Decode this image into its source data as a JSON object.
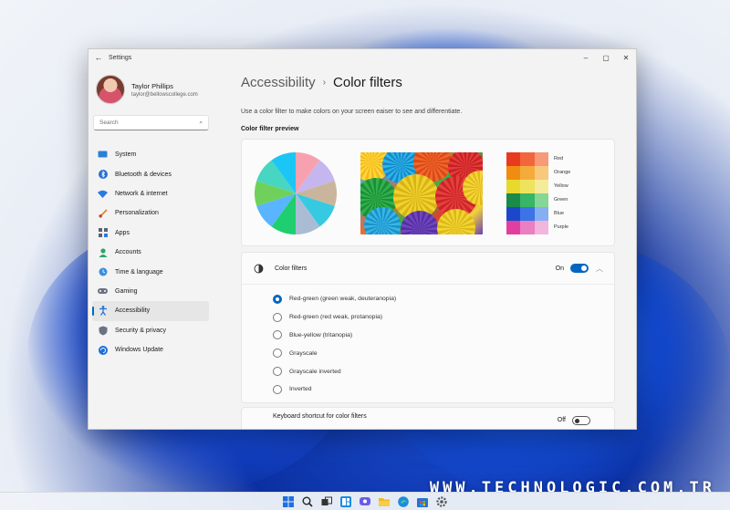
{
  "window": {
    "title": "Settings",
    "controls": [
      "–",
      "▢",
      "✕"
    ]
  },
  "profile": {
    "name": "Taylor Phillips",
    "email": "taylor@bellowscollege.com"
  },
  "search": {
    "placeholder": "Search"
  },
  "sidebar": {
    "items": [
      {
        "label": "System",
        "icon": "monitor-icon"
      },
      {
        "label": "Bluetooth & devices",
        "icon": "bluetooth-icon"
      },
      {
        "label": "Network & internet",
        "icon": "wifi-icon"
      },
      {
        "label": "Personalization",
        "icon": "brush-icon"
      },
      {
        "label": "Apps",
        "icon": "apps-icon"
      },
      {
        "label": "Accounts",
        "icon": "person-icon"
      },
      {
        "label": "Time & language",
        "icon": "globe-clock-icon"
      },
      {
        "label": "Gaming",
        "icon": "gamepad-icon"
      },
      {
        "label": "Accessibility",
        "icon": "accessibility-icon",
        "active": true
      },
      {
        "label": "Security & privacy",
        "icon": "shield-icon"
      },
      {
        "label": "Windows Update",
        "icon": "update-icon"
      }
    ]
  },
  "breadcrumb": {
    "parent": "Accessibility",
    "separator": "›",
    "current": "Color filters"
  },
  "description": "Use a color filter to make colors on your screen eaiser to see and differentiate.",
  "preview": {
    "title": "Color filter preview",
    "pie_colors": [
      "#f7a1b0",
      "#c5b6ef",
      "#c9b59b",
      "#36c9e2",
      "#a9bcd4",
      "#1fcf6f",
      "#59b5ff",
      "#6fd15b",
      "#47d6c1",
      "#1bc6f5"
    ],
    "swatches": [
      {
        "label": "Red",
        "colors": [
          "#e83a1e",
          "#f2663d",
          "#f79a78"
        ]
      },
      {
        "label": "Orange",
        "colors": [
          "#f08c10",
          "#f5ab3c",
          "#f8c87c"
        ]
      },
      {
        "label": "Yellow",
        "colors": [
          "#e8d92c",
          "#efe35e",
          "#f4ec9a"
        ]
      },
      {
        "label": "Green",
        "colors": [
          "#1b8a4a",
          "#38b566",
          "#84d796"
        ]
      },
      {
        "label": "Blue",
        "colors": [
          "#1b47c9",
          "#3c73e6",
          "#86aef2"
        ]
      },
      {
        "label": "Purple",
        "colors": [
          "#e23ea0",
          "#ea7fc1",
          "#f2b6dc"
        ]
      }
    ]
  },
  "color_filters": {
    "label": "Color filters",
    "state": "On",
    "toggle_on": true,
    "options": [
      {
        "label": "Red-green (green weak, deuteranopia)",
        "checked": true
      },
      {
        "label": "Red-green (red weak, protanopia)",
        "checked": false
      },
      {
        "label": "Blue-yellow (tritanopia)",
        "checked": false
      },
      {
        "label": "Grayscale",
        "checked": false
      },
      {
        "label": "Grayscale inverted",
        "checked": false
      },
      {
        "label": "Inverted",
        "checked": false
      }
    ]
  },
  "keyboard_shortcut": {
    "label": "Keyboard shortcut for color filters",
    "state": "Off",
    "toggle_on": false
  },
  "watermark": "WWW.TECHNOLOGIC.COM.TR",
  "taskbar": {
    "icons": [
      "windows-start-icon",
      "search-icon",
      "task-view-icon",
      "widgets-icon",
      "chat-icon",
      "file-explorer-icon",
      "edge-icon",
      "store-icon",
      "settings-icon"
    ]
  }
}
